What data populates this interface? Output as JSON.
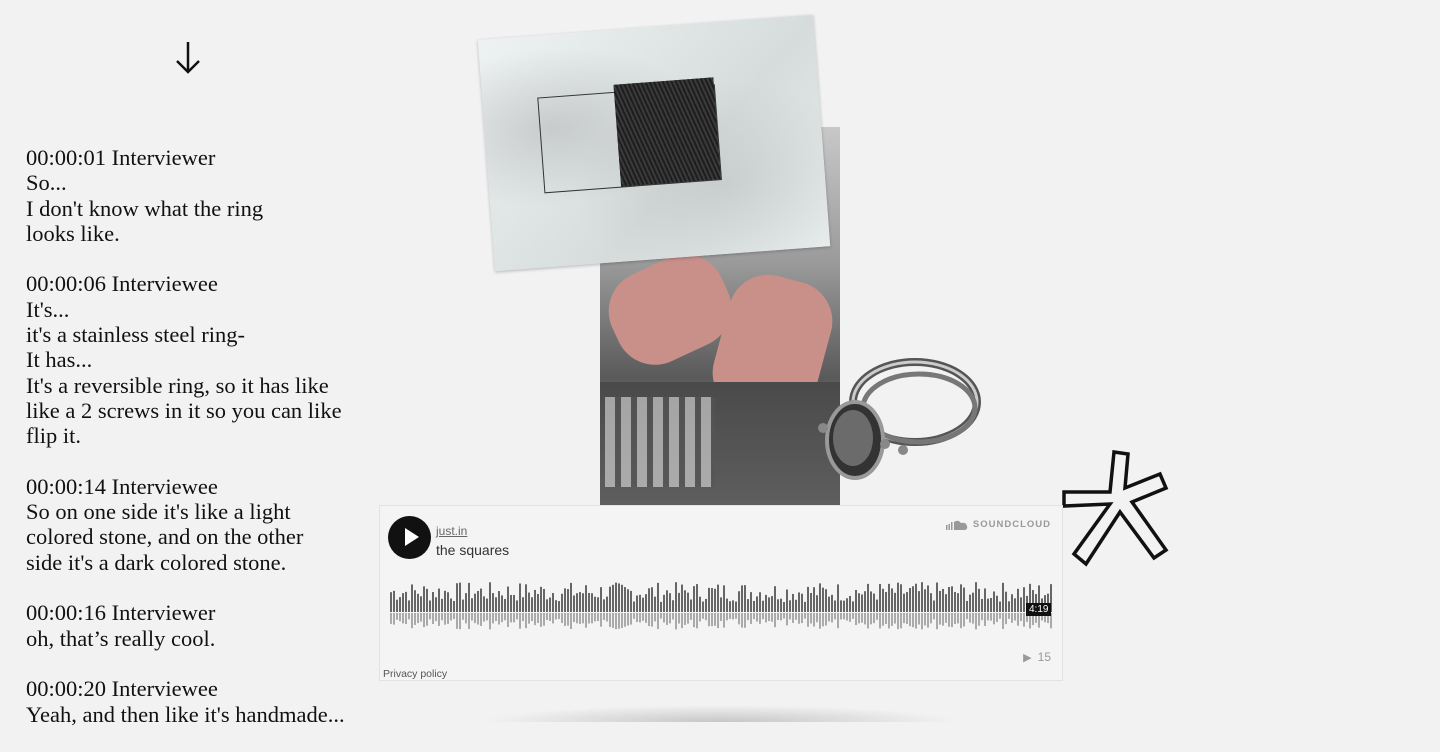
{
  "icons": {
    "scroll": "arrow-down-icon",
    "soundcloud": "soundcloud-cloud-icon",
    "play": "play-icon",
    "plays": "play-count-icon",
    "decor": "asterisk-icon"
  },
  "transcript": [
    {
      "time": "00:00:01 Interviewer",
      "lines": [
        "So...",
        "I don't know what the ring",
        "looks like."
      ]
    },
    {
      "time": "00:00:06 Interviewee",
      "lines": [
        "It's...",
        "it's a stainless steel ring-",
        "It has...",
        "It's a reversible ring, so it has like",
        "like a 2 screws in it so you can like",
        "flip it."
      ]
    },
    {
      "time": "00:00:14 Interviewee",
      "lines": [
        "So on one side it's like a light",
        "colored stone, and on the other",
        "side it's a dark colored stone."
      ]
    },
    {
      "time": "00:00:16 Interviewer",
      "lines": [
        "oh, that’s really cool."
      ]
    },
    {
      "time": "00:00:20 Interviewee",
      "lines": [
        "Yeah, and then like it's handmade..."
      ]
    }
  ],
  "player": {
    "user": "just.in",
    "title": "the squares",
    "brand": "SOUNDCLOUD",
    "duration": "4:19",
    "plays": "15",
    "privacy": "Privacy policy"
  },
  "colors": {
    "background": "#f2f2f2",
    "text": "#111111",
    "waveform": "#666666"
  }
}
